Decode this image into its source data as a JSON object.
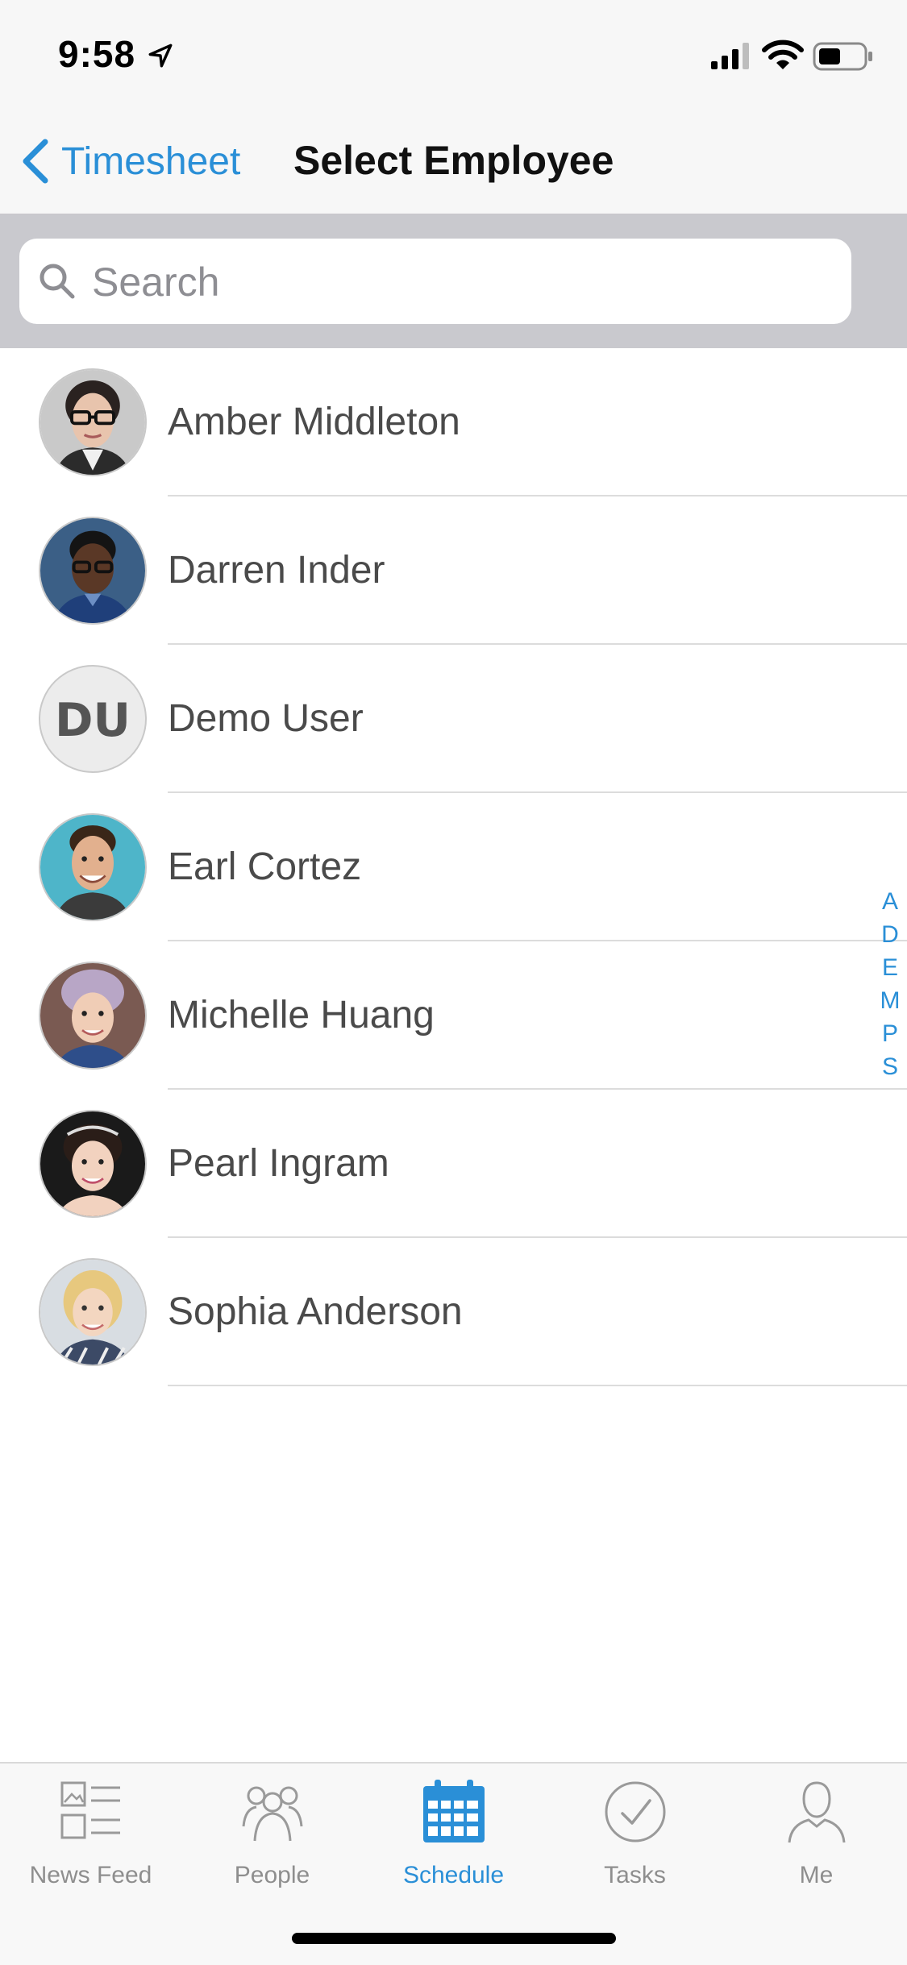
{
  "status_bar": {
    "time": "9:58"
  },
  "nav": {
    "back_label": "Timesheet",
    "title": "Select Employee"
  },
  "search": {
    "placeholder": "Search",
    "value": ""
  },
  "employees": [
    {
      "name": "Amber Middleton"
    },
    {
      "name": "Darren Inder"
    },
    {
      "name": "Demo User",
      "initials": "DU"
    },
    {
      "name": "Earl Cortez"
    },
    {
      "name": "Michelle Huang"
    },
    {
      "name": "Pearl Ingram"
    },
    {
      "name": "Sophia Anderson"
    }
  ],
  "index_letters": [
    "A",
    "D",
    "E",
    "M",
    "P",
    "S"
  ],
  "tabs": [
    {
      "label": "News Feed",
      "icon": "news-feed-icon"
    },
    {
      "label": "People",
      "icon": "people-icon"
    },
    {
      "label": "Schedule",
      "icon": "calendar-icon",
      "active": true
    },
    {
      "label": "Tasks",
      "icon": "checkmark-circle-icon"
    },
    {
      "label": "Me",
      "icon": "person-icon"
    }
  ],
  "colors": {
    "accent": "#2a8fd7",
    "inactive": "#8e8e8e",
    "search_bar_bg": "#c9c9ce"
  }
}
